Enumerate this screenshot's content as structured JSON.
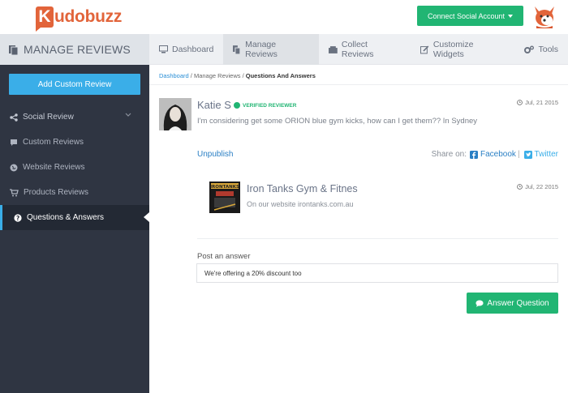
{
  "app": {
    "logo_letter": "K",
    "logo_text": "udobuzz"
  },
  "header": {
    "connect_label": "Connect Social Account"
  },
  "subheader": {
    "title": "MANAGE REVIEWS"
  },
  "nav": {
    "items": [
      {
        "label": "Dashboard",
        "icon": "monitor-icon"
      },
      {
        "label": "Manage Reviews",
        "icon": "copy-icon"
      },
      {
        "label": "Collect Reviews",
        "icon": "inbox-icon"
      },
      {
        "label": "Customize Widgets",
        "icon": "edit-icon"
      },
      {
        "label": "Tools",
        "icon": "cogs-icon"
      }
    ]
  },
  "sidebar": {
    "add_label": "Add Custom Review",
    "items": [
      {
        "label": "Social Review",
        "icon": "share-icon"
      },
      {
        "label": "Custom Reviews",
        "icon": "comment-icon"
      },
      {
        "label": "Website Reviews",
        "icon": "globe-icon"
      },
      {
        "label": "Products Reviews",
        "icon": "cart-icon"
      },
      {
        "label": "Questions & Answers",
        "icon": "question-circle-icon"
      }
    ]
  },
  "breadcrumb": {
    "part1": "Dashboard",
    "part2": "Manage Reviews",
    "current": "Questions And Answers"
  },
  "question": {
    "name": "Katie S",
    "verified": "VERIFIED REVIEWER",
    "date": "Jul, 21 2015",
    "text": "I'm considering get some ORION blue gym kicks, how can I get them?? In Sydney"
  },
  "actions": {
    "unpublish": "Unpublish",
    "share_label": "Share on:",
    "facebook": "Facebook",
    "twitter": "Twitter"
  },
  "answer": {
    "name": "Iron Tanks Gym & Fitnes",
    "text": "On our website irontanks.com.au",
    "date": "Jul, 22 2015",
    "thumb_text": "IRONTANKS"
  },
  "post": {
    "label": "Post an answer",
    "value": "We're offering a 20% discount too",
    "button": "Answer Question"
  },
  "colors": {
    "green": "#21b573",
    "blue": "#3aaee8",
    "link": "#2a7fc4",
    "sidebar": "#2f3542",
    "brand": "#e2643a"
  }
}
